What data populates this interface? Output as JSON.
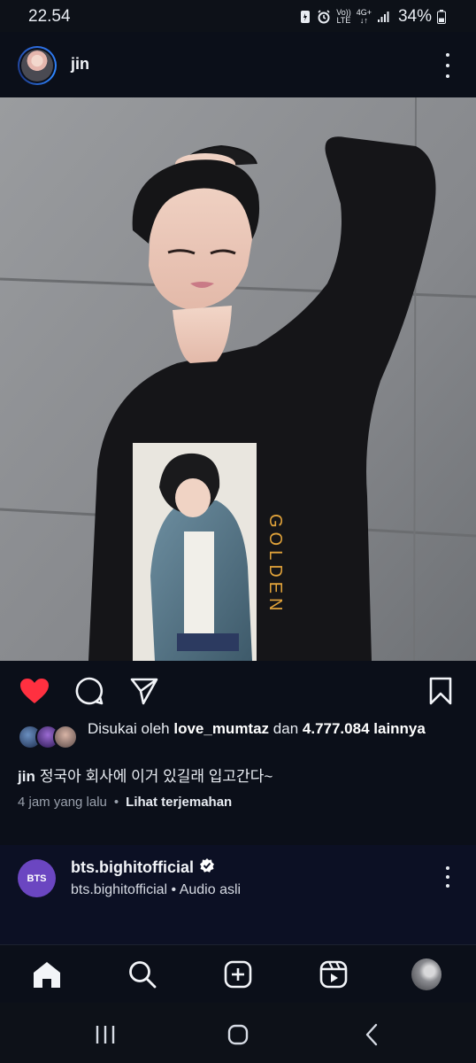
{
  "status_bar": {
    "time": "22.54",
    "volte": "Vo))",
    "lte": "LTE",
    "net": "4G+",
    "battery": "34%"
  },
  "post": {
    "username": "jin",
    "likes_prefix": "Disukai oleh",
    "likes_user": "love_mumtaz",
    "likes_and": "dan",
    "likes_count": "4.777.084",
    "likes_suffix": "lainnya",
    "caption_user": "jin",
    "caption_text": "정국아 회사에 이거 있길래 입고간다~",
    "time_ago": "4 jam yang lalu",
    "separator": "•",
    "translate_label": "Lihat terjemahan",
    "liked": true,
    "shirt_text": "GOLDEN"
  },
  "next_post": {
    "avatar_text": "BTS",
    "username": "bts.bighitofficial",
    "subtitle": "bts.bighitofficial • Audio asli"
  },
  "colors": {
    "background": "#0b0f19",
    "like_red": "#ff3040",
    "text": "#f2f4f8",
    "muted": "#9aa1ad"
  },
  "icons": {
    "actions": [
      "heart-icon",
      "comment-icon",
      "share-icon",
      "save-icon"
    ],
    "nav": [
      "home-icon",
      "search-icon",
      "create-icon",
      "reels-icon",
      "profile-avatar"
    ],
    "system": [
      "recents-icon",
      "home-circle-icon",
      "back-icon"
    ]
  }
}
